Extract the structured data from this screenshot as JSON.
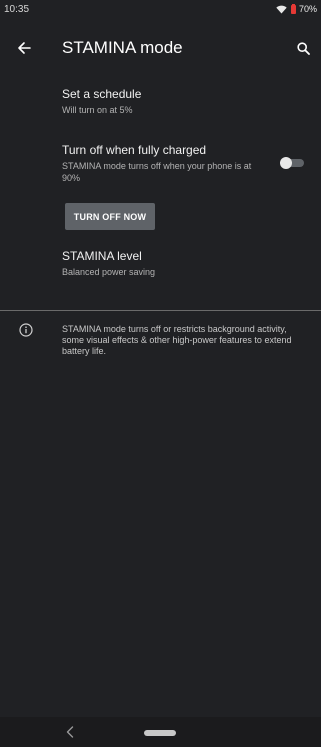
{
  "status_bar": {
    "time": "10:35",
    "battery_percent": "70%",
    "battery_color": "#e53935"
  },
  "app_bar": {
    "title": "STAMINA mode",
    "back_icon": "arrow-left-icon",
    "search_icon": "search-icon"
  },
  "schedule": {
    "title": "Set a schedule",
    "summary": "Will turn on at 5%"
  },
  "turn_off_when_charged": {
    "title": "Turn off when fully charged",
    "summary": "STAMINA mode turns off when your phone is at 90%",
    "toggle_on": false
  },
  "turn_off_now": {
    "label": "TURN OFF NOW"
  },
  "stamina_level": {
    "title": "STAMINA level",
    "summary": "Balanced power saving"
  },
  "info": {
    "icon": "info-icon",
    "text": "STAMINA mode turns off or restricts background activity, some visual effects & other high-power features to extend battery life."
  },
  "nav_bar": {
    "back_icon": "chevron-left-icon",
    "home_icon": "home-pill-icon"
  },
  "colors": {
    "background": "#202124",
    "button_background": "#5f6368",
    "divider": "#6a6a6a"
  }
}
